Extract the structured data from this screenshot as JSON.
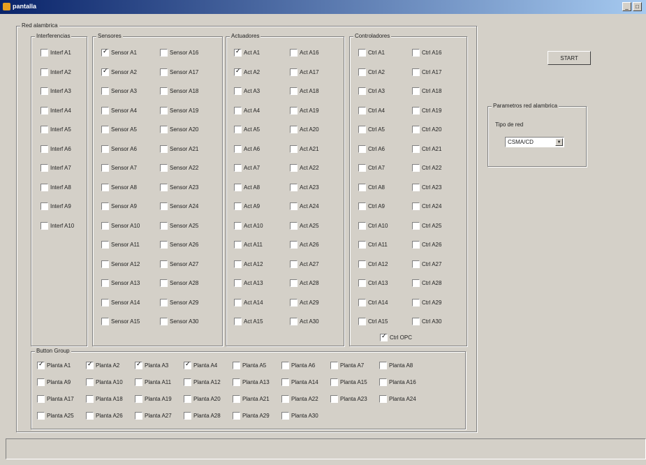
{
  "window": {
    "title": "pantalla"
  },
  "panels": {
    "main": "Red alambrica",
    "interferencias": "Interferencias",
    "sensores": "Sensores",
    "actuadores": "Actuadores",
    "controladores": "Controladores",
    "button_group": "Button Group",
    "parametros": "Parametros red alambrica"
  },
  "interferencias": [
    {
      "label": "Interf A1",
      "checked": false
    },
    {
      "label": "Interf A2",
      "checked": false
    },
    {
      "label": "Interf A3",
      "checked": false
    },
    {
      "label": "Interf A4",
      "checked": false
    },
    {
      "label": "Interf A5",
      "checked": false
    },
    {
      "label": "Interf A6",
      "checked": false
    },
    {
      "label": "Interf A7",
      "checked": false
    },
    {
      "label": "Interf A8",
      "checked": false
    },
    {
      "label": "Interf A9",
      "checked": false
    },
    {
      "label": "Interf A10",
      "checked": false
    }
  ],
  "sensores": [
    {
      "label": "Sensor A1",
      "checked": true
    },
    {
      "label": "Sensor A2",
      "checked": true
    },
    {
      "label": "Sensor A3",
      "checked": false
    },
    {
      "label": "Sensor A4",
      "checked": false
    },
    {
      "label": "Sensor A5",
      "checked": false
    },
    {
      "label": "Sensor A6",
      "checked": false
    },
    {
      "label": "Sensor A7",
      "checked": false
    },
    {
      "label": "Sensor A8",
      "checked": false
    },
    {
      "label": "Sensor A9",
      "checked": false
    },
    {
      "label": "Sensor A10",
      "checked": false
    },
    {
      "label": "Sensor A11",
      "checked": false
    },
    {
      "label": "Sensor A12",
      "checked": false
    },
    {
      "label": "Sensor A13",
      "checked": false
    },
    {
      "label": "Sensor A14",
      "checked": false
    },
    {
      "label": "Sensor A15",
      "checked": false
    },
    {
      "label": "Sensor A16",
      "checked": false
    },
    {
      "label": "Sensor A17",
      "checked": false
    },
    {
      "label": "Sensor A18",
      "checked": false
    },
    {
      "label": "Sensor A19",
      "checked": false
    },
    {
      "label": "Sensor A20",
      "checked": false
    },
    {
      "label": "Sensor A21",
      "checked": false
    },
    {
      "label": "Sensor A22",
      "checked": false
    },
    {
      "label": "Sensor A23",
      "checked": false
    },
    {
      "label": "Sensor A24",
      "checked": false
    },
    {
      "label": "Sensor A25",
      "checked": false
    },
    {
      "label": "Sensor A26",
      "checked": false
    },
    {
      "label": "Sensor A27",
      "checked": false
    },
    {
      "label": "Sensor A28",
      "checked": false
    },
    {
      "label": "Sensor A29",
      "checked": false
    },
    {
      "label": "Sensor A30",
      "checked": false
    }
  ],
  "actuadores": [
    {
      "label": "Act A1",
      "checked": true
    },
    {
      "label": "Act A2",
      "checked": true
    },
    {
      "label": "Act A3",
      "checked": false
    },
    {
      "label": "Act A4",
      "checked": false
    },
    {
      "label": "Act A5",
      "checked": false
    },
    {
      "label": "Act A6",
      "checked": false
    },
    {
      "label": "Act A7",
      "checked": false
    },
    {
      "label": "Act A8",
      "checked": false
    },
    {
      "label": "Act A9",
      "checked": false
    },
    {
      "label": "Act A10",
      "checked": false
    },
    {
      "label": "Act A11",
      "checked": false
    },
    {
      "label": "Act A12",
      "checked": false
    },
    {
      "label": "Act A13",
      "checked": false
    },
    {
      "label": "Act A14",
      "checked": false
    },
    {
      "label": "Act A15",
      "checked": false
    },
    {
      "label": "Act A16",
      "checked": false
    },
    {
      "label": "Act A17",
      "checked": false
    },
    {
      "label": "Act A18",
      "checked": false
    },
    {
      "label": "Act A19",
      "checked": false
    },
    {
      "label": "Act A20",
      "checked": false
    },
    {
      "label": "Act A21",
      "checked": false
    },
    {
      "label": "Act A22",
      "checked": false
    },
    {
      "label": "Act A23",
      "checked": false
    },
    {
      "label": "Act A24",
      "checked": false
    },
    {
      "label": "Act A25",
      "checked": false
    },
    {
      "label": "Act A26",
      "checked": false
    },
    {
      "label": "Act A27",
      "checked": false
    },
    {
      "label": "Act A28",
      "checked": false
    },
    {
      "label": "Act A29",
      "checked": false
    },
    {
      "label": "Act A30",
      "checked": false
    }
  ],
  "controladores": [
    {
      "label": "Ctrl A1",
      "checked": false
    },
    {
      "label": "Ctrl A2",
      "checked": false
    },
    {
      "label": "Ctrl A3",
      "checked": false
    },
    {
      "label": "Ctrl A4",
      "checked": false
    },
    {
      "label": "Ctrl A5",
      "checked": false
    },
    {
      "label": "Ctrl A6",
      "checked": false
    },
    {
      "label": "Ctrl A7",
      "checked": false
    },
    {
      "label": "Ctrl A8",
      "checked": false
    },
    {
      "label": "Ctrl A9",
      "checked": false
    },
    {
      "label": "Ctrl A10",
      "checked": false
    },
    {
      "label": "Ctrl A11",
      "checked": false
    },
    {
      "label": "Ctrl A12",
      "checked": false
    },
    {
      "label": "Ctrl A13",
      "checked": false
    },
    {
      "label": "Ctrl A14",
      "checked": false
    },
    {
      "label": "Ctrl A15",
      "checked": false
    },
    {
      "label": "Ctrl A16",
      "checked": false
    },
    {
      "label": "Ctrl A17",
      "checked": false
    },
    {
      "label": "Ctrl A18",
      "checked": false
    },
    {
      "label": "Ctrl A19",
      "checked": false
    },
    {
      "label": "Ctrl A20",
      "checked": false
    },
    {
      "label": "Ctrl A21",
      "checked": false
    },
    {
      "label": "Ctrl A22",
      "checked": false
    },
    {
      "label": "Ctrl A23",
      "checked": false
    },
    {
      "label": "Ctrl A24",
      "checked": false
    },
    {
      "label": "Ctrl A25",
      "checked": false
    },
    {
      "label": "Ctrl A26",
      "checked": false
    },
    {
      "label": "Ctrl A27",
      "checked": false
    },
    {
      "label": "Ctrl A28",
      "checked": false
    },
    {
      "label": "Ctrl A29",
      "checked": false
    },
    {
      "label": "Ctrl A30",
      "checked": false
    }
  ],
  "ctrl_opc": {
    "label": "Ctrl OPC",
    "checked": true
  },
  "plantas": [
    {
      "label": "Planta A1",
      "checked": true
    },
    {
      "label": "Planta A2",
      "checked": true
    },
    {
      "label": "Planta A3",
      "checked": true
    },
    {
      "label": "Planta A4",
      "checked": true
    },
    {
      "label": "Planta A5",
      "checked": false
    },
    {
      "label": "Planta A6",
      "checked": false
    },
    {
      "label": "Planta A7",
      "checked": false
    },
    {
      "label": "Planta A8",
      "checked": false
    },
    {
      "label": "Planta A9",
      "checked": false
    },
    {
      "label": "Planta A10",
      "checked": false
    },
    {
      "label": "Planta A11",
      "checked": false
    },
    {
      "label": "Planta A12",
      "checked": false
    },
    {
      "label": "Planta A13",
      "checked": false
    },
    {
      "label": "Planta A14",
      "checked": false
    },
    {
      "label": "Planta A15",
      "checked": false
    },
    {
      "label": "Planta A16",
      "checked": false
    },
    {
      "label": "Planta A17",
      "checked": false
    },
    {
      "label": "Planta A18",
      "checked": false
    },
    {
      "label": "Planta A19",
      "checked": false
    },
    {
      "label": "Planta A20",
      "checked": false
    },
    {
      "label": "Planta A21",
      "checked": false
    },
    {
      "label": "Planta A22",
      "checked": false
    },
    {
      "label": "Planta A23",
      "checked": false
    },
    {
      "label": "Planta A24",
      "checked": false
    },
    {
      "label": "Planta A25",
      "checked": false
    },
    {
      "label": "Planta A26",
      "checked": false
    },
    {
      "label": "Planta A27",
      "checked": false
    },
    {
      "label": "Planta A28",
      "checked": false
    },
    {
      "label": "Planta A29",
      "checked": false
    },
    {
      "label": "Planta A30",
      "checked": false
    }
  ],
  "start_label": "START",
  "tipo_red": {
    "label": "Tipo de red",
    "value": "CSMA/CD"
  },
  "window_controls": {
    "minimize": "_",
    "maximize": "□"
  }
}
